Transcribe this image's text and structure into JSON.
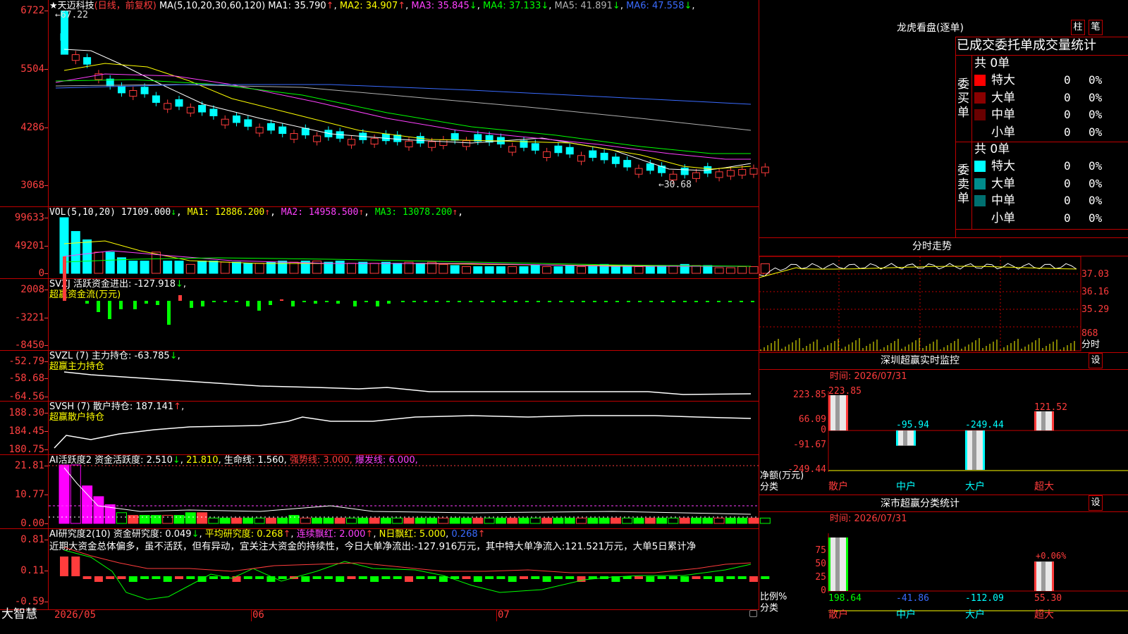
{
  "main_chart": {
    "star": "★",
    "stock_name": "天迈科技",
    "period": "(日线，前复权)",
    "ma_label": "MA(5,10,20,30,60,120)",
    "ma": [
      {
        "label": "MA1:",
        "value": "35.790",
        "arrow": "↑",
        "color": "#ffffff"
      },
      {
        "label": "MA2:",
        "value": "34.907",
        "arrow": "↑",
        "color": "#ffff00"
      },
      {
        "label": "MA3:",
        "value": "35.845",
        "arrow": "↓",
        "color": "#ff40ff"
      },
      {
        "label": "MA4:",
        "value": "37.133",
        "arrow": "↓",
        "color": "#00ff00"
      },
      {
        "label": "MA5:",
        "value": "41.891",
        "arrow": "↓",
        "color": "#b0b0b0"
      },
      {
        "label": "MA6:",
        "value": "47.558",
        "arrow": "↓",
        "color": "#3a6bff"
      }
    ],
    "yticks": [
      "6722",
      "5504",
      "4286",
      "3068"
    ],
    "high_marker": "←67.22",
    "low_marker": "←30.68",
    "colors": {
      "up": "#ff3c3c",
      "down": "#00ffff",
      "frame": "#c00000"
    }
  },
  "vol_panel": {
    "title": "VOL(5,10,20)",
    "value": "17109.000",
    "arrow": "↓",
    "ma": [
      {
        "label": "MA1:",
        "value": "12886.200",
        "arrow": "↑",
        "color": "#ffff00"
      },
      {
        "label": "MA2:",
        "value": "14958.500",
        "arrow": "↑",
        "color": "#ff40ff"
      },
      {
        "label": "MA3:",
        "value": "13078.200",
        "arrow": "↑",
        "color": "#00ff00"
      }
    ],
    "yticks": [
      "99633",
      "49201",
      "0"
    ]
  },
  "svzj_panel": {
    "title": "SVZJ",
    "label": "活跃资金进出:",
    "value": "-127.918",
    "arrow": "↓",
    "subtitle": "超赢资金流(万元)",
    "yticks": [
      "2008",
      "-3221",
      "-8450"
    ]
  },
  "svzl_panel": {
    "title": "SVZL (7)",
    "label": "主力持仓:",
    "value": "-63.785",
    "arrow": "↓",
    "subtitle": "超赢主力持仓",
    "yticks": [
      "-52.79",
      "-58.68",
      "-64.56"
    ]
  },
  "svsh_panel": {
    "title": "SVSH (7)",
    "label": "散户持仓:",
    "value": "187.141",
    "arrow": "↑",
    "subtitle": "超赢散户持仓",
    "yticks": [
      "188.30",
      "184.45",
      "180.75"
    ]
  },
  "ai_active": {
    "title": "AI活跃度2",
    "label1": "资金活跃度:",
    "value1": "2.510",
    "arrow1": "↓",
    "value2": "21.810",
    "label3": "生命线:",
    "value3": "1.560",
    "label4": "强势线:",
    "value4": "3.000",
    "label5": "爆发线:",
    "value5": "6.000",
    "yticks": [
      "21.81",
      "10.77",
      "0.00"
    ]
  },
  "ai_research": {
    "title": "AI研究度2(10)",
    "label1": "资金研究度:",
    "value1": "0.049",
    "arrow1": "↓",
    "label2": "平均研究度:",
    "value2": "0.268",
    "arrow2": "↑",
    "label3": "连续飘红:",
    "value3": "2.000",
    "arrow3": "↑",
    "label4": "N日飘红:",
    "value4": "5.000",
    "value5": "0.268",
    "arrow5": "↑",
    "comment": "近期大资金总体偏多，虽不活跃，但有异动，宜关注大资金的持续性，今日大单净流出:-127.916万元，其中特大单净流入:121.521万元，大单5日累计净",
    "yticks": [
      "0.81",
      "0.11",
      "-0.59"
    ]
  },
  "bottom_axis": {
    "brand": "大智慧",
    "dates": [
      "2026/05",
      "06",
      "07"
    ]
  },
  "dragon_tiger": {
    "title": "龙虎看盘(逐单)",
    "btn1": "柱",
    "btn2": "笔",
    "header": "已成交委托单成交量统计",
    "buy_label": "委买单",
    "sell_label": "委卖单",
    "buy_total": "共 0单",
    "sell_total": "共 0单",
    "buy_rows": [
      {
        "name": "特大",
        "count": "0",
        "pct": "0%",
        "color": "#ff0000"
      },
      {
        "name": "大单",
        "count": "0",
        "pct": "0%",
        "color": "#8b0000"
      },
      {
        "name": "中单",
        "count": "0",
        "pct": "0%",
        "color": "#6a0000"
      },
      {
        "name": "小单",
        "count": "0",
        "pct": "0%",
        "color": "#000000"
      }
    ],
    "sell_rows": [
      {
        "name": "特大",
        "count": "0",
        "pct": "0%",
        "color": "#00ffff"
      },
      {
        "name": "大单",
        "count": "0",
        "pct": "0%",
        "color": "#008b8b"
      },
      {
        "name": "中单",
        "count": "0",
        "pct": "0%",
        "color": "#007070"
      },
      {
        "name": "小单",
        "count": "0",
        "pct": "0%",
        "color": "#000000"
      }
    ]
  },
  "intraday": {
    "title": "分时走势",
    "prices": [
      "37.03",
      "36.16",
      "35.29"
    ],
    "vol": "868",
    "vol_unit": "分时"
  },
  "sz_monitor": {
    "title": "深圳超赢实时监控",
    "btn": "设",
    "time_label": "时间:",
    "time_value": "2026/07/31",
    "yticks": [
      "223.85",
      "66.09",
      "0",
      "-91.67",
      "-249.44"
    ],
    "unit": "净额(万元)",
    "cat_label": "分类",
    "bars": [
      {
        "name": "散户",
        "value": 223.85,
        "label": "223.85"
      },
      {
        "name": "中户",
        "value": -95.94,
        "label": "-95.94"
      },
      {
        "name": "大户",
        "value": -249.44,
        "label": "-249.44"
      },
      {
        "name": "超大",
        "value": 121.52,
        "label": "121.52"
      }
    ]
  },
  "sz_stats": {
    "title": "深市超赢分类统计",
    "btn": "设",
    "time_label": "时间:",
    "time_value": "2026/07/31",
    "yticks": [
      "75",
      "50",
      "25",
      "0"
    ],
    "unit": "比例%",
    "cat_label": "分类",
    "pct_label": "+0.06%",
    "bars": [
      {
        "name": "散户",
        "value": 198.64,
        "label": "198.64",
        "pct": 100
      },
      {
        "name": "中户",
        "value": -41.86,
        "label": "-41.86",
        "pct": 0
      },
      {
        "name": "大户",
        "value": -112.09,
        "label": "-112.09",
        "pct": 0
      },
      {
        "name": "超大",
        "value": 55.3,
        "label": "55.30",
        "pct": 55
      }
    ]
  }
}
